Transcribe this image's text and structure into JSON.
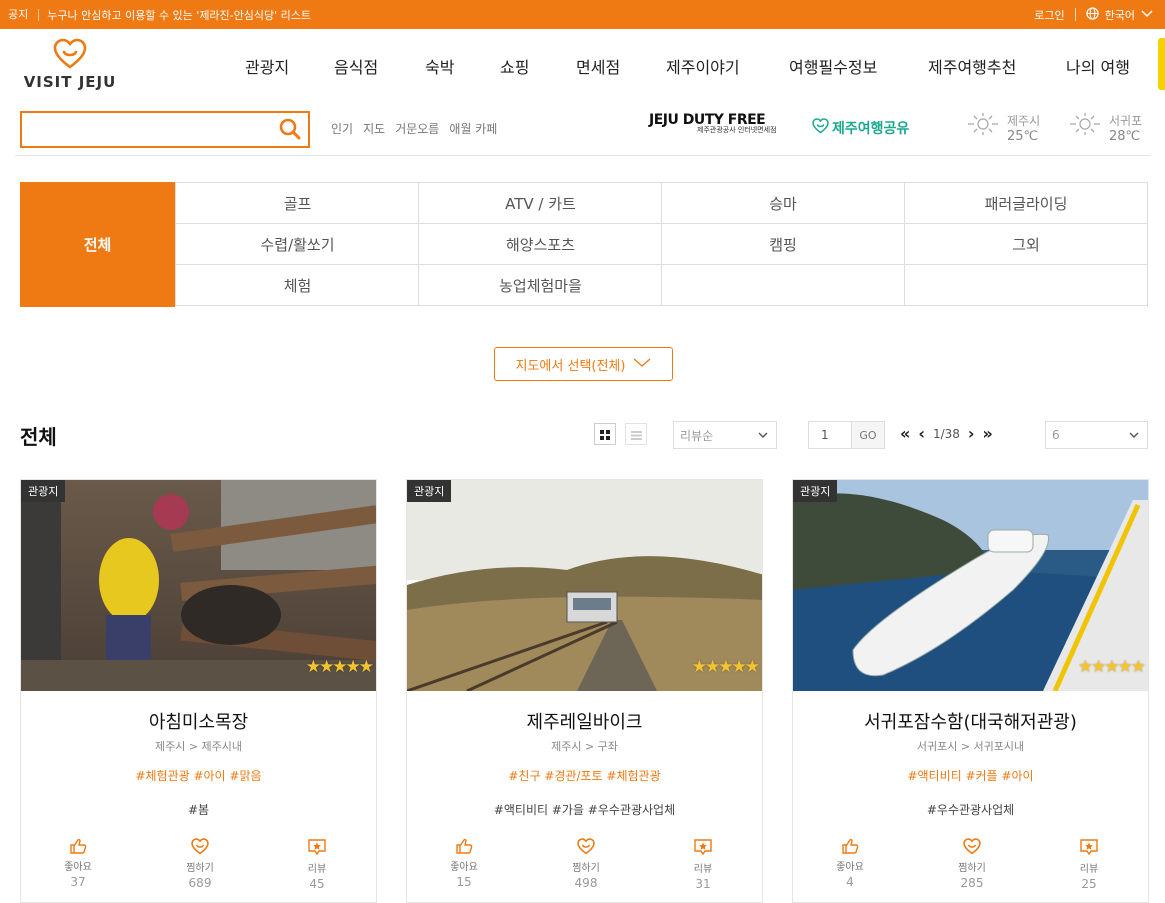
{
  "notice": {
    "tag": "공지",
    "message": "누구나 안심하고 이용할 수 있는 '제라진-안심식당' 리스트",
    "login": "로그인",
    "language": "한국어"
  },
  "logo": {
    "text": "VISIT JEJU"
  },
  "gnb": [
    "관광지",
    "음식점",
    "숙박",
    "쇼핑",
    "면세점",
    "제주이야기",
    "여행필수정보",
    "제주여행추천",
    "나의 여행"
  ],
  "search": {
    "placeholder": "",
    "keywords": [
      "인기",
      "지도",
      "거문오름",
      "애월 카페"
    ]
  },
  "banners": {
    "duty_free": "JEJU DUTY FREE",
    "duty_free_sub": "제주관광공사 인터넷면세점",
    "share": "제주여행공유"
  },
  "weather": [
    {
      "city": "제주시",
      "temp": "25℃"
    },
    {
      "city": "서귀포",
      "temp": "28℃"
    }
  ],
  "categories": {
    "all": "전체",
    "items": [
      "골프",
      "ATV / 카트",
      "승마",
      "패러글라이딩",
      "수렵/활쏘기",
      "해양스포츠",
      "캠핑",
      "그외",
      "체험",
      "농업체험마을",
      "",
      ""
    ]
  },
  "map_select": "지도에서 선택(전체)",
  "list": {
    "title": "전체",
    "sort": "리뷰순",
    "page": "1",
    "go": "GO",
    "page_status": "1/38",
    "per_page": "6"
  },
  "cards": [
    {
      "badge": "관광지",
      "title": "아침미소목장",
      "location": "제주시 > 제주시내",
      "tags_primary": "#체험관광 #아이 #맑음",
      "tags_secondary": "#봄",
      "like_label": "좋아요",
      "likes": "37",
      "pick_label": "찜하기",
      "picks": "689",
      "review_label": "리뷰",
      "reviews": "45",
      "rating": 5
    },
    {
      "badge": "관광지",
      "title": "제주레일바이크",
      "location": "제주시 > 구좌",
      "tags_primary": "#친구 #경관/포토 #체험관광",
      "tags_secondary": "#액티비티 #가을 #우수관광사업체",
      "like_label": "좋아요",
      "likes": "15",
      "pick_label": "찜하기",
      "picks": "498",
      "review_label": "리뷰",
      "reviews": "31",
      "rating": 5
    },
    {
      "badge": "관광지",
      "title": "서귀포잠수함(대국해저관광)",
      "location": "서귀포시 > 서귀포시내",
      "tags_primary": "#액티비티 #커플 #아이",
      "tags_secondary": "#우수관광사업체",
      "like_label": "좋아요",
      "likes": "4",
      "pick_label": "찜하기",
      "picks": "285",
      "review_label": "리뷰",
      "reviews": "25",
      "rating": 5
    }
  ],
  "colors": {
    "accent": "#ef7a14",
    "share_green": "#1ba88f"
  }
}
